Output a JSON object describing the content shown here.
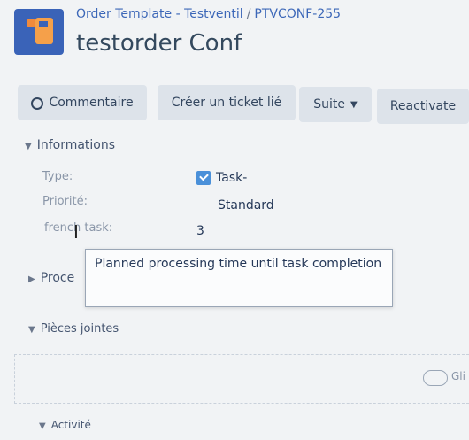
{
  "header": {
    "breadcrumb_project": "Order Template - Testventil",
    "breadcrumb_sep": "/",
    "breadcrumb_issue": "PTVCONF-255",
    "title": "testorder Conf"
  },
  "toolbar": {
    "comment_label": "Commentaire",
    "create_linked_ticket_label": "Créer un ticket lié",
    "suite_label": "Suite",
    "reactivate_label": "Reactivate"
  },
  "details": {
    "section_title": "Informations",
    "type_label": "Type:",
    "type_value": "Task-",
    "priority_label": "Priorité:",
    "priority_value": "Standard",
    "french_task_label": "french task:",
    "french_task_value": "3"
  },
  "tooltip": {
    "text": "Planned processing time until task completion"
  },
  "sections": {
    "process_title": "Proce",
    "attachments_title": "Pièces jointes",
    "activity_title": "Activité"
  },
  "dropzone": {
    "label": "Gli"
  },
  "colors": {
    "link": "#3c67b8",
    "button_bg": "#dde3ea",
    "avatar_bg": "#3a63b8",
    "avatar_accent": "#f5a04a",
    "task_icon": "#4a90d9"
  }
}
